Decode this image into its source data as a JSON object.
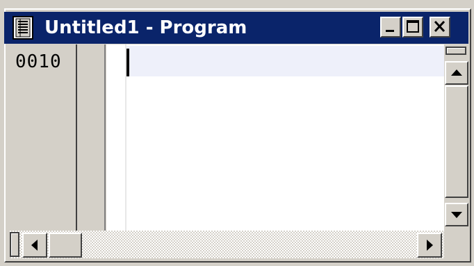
{
  "window": {
    "title": "Untitled1 - Program",
    "icon": "document-icon"
  },
  "titlebar_buttons": {
    "minimize": "minimize-icon",
    "maximize": "maximize-icon",
    "close": "close-icon"
  },
  "editor": {
    "line_numbers": [
      "0010"
    ],
    "content": ""
  },
  "scrollbars": {
    "vertical_up": "arrow-up-icon",
    "vertical_down": "arrow-down-icon",
    "horizontal_left": "arrow-left-icon",
    "horizontal_right": "arrow-right-icon"
  },
  "colors": {
    "title_bar": "#0a246a",
    "window_face": "#d4d0c8",
    "current_line": "#eef0fa"
  }
}
